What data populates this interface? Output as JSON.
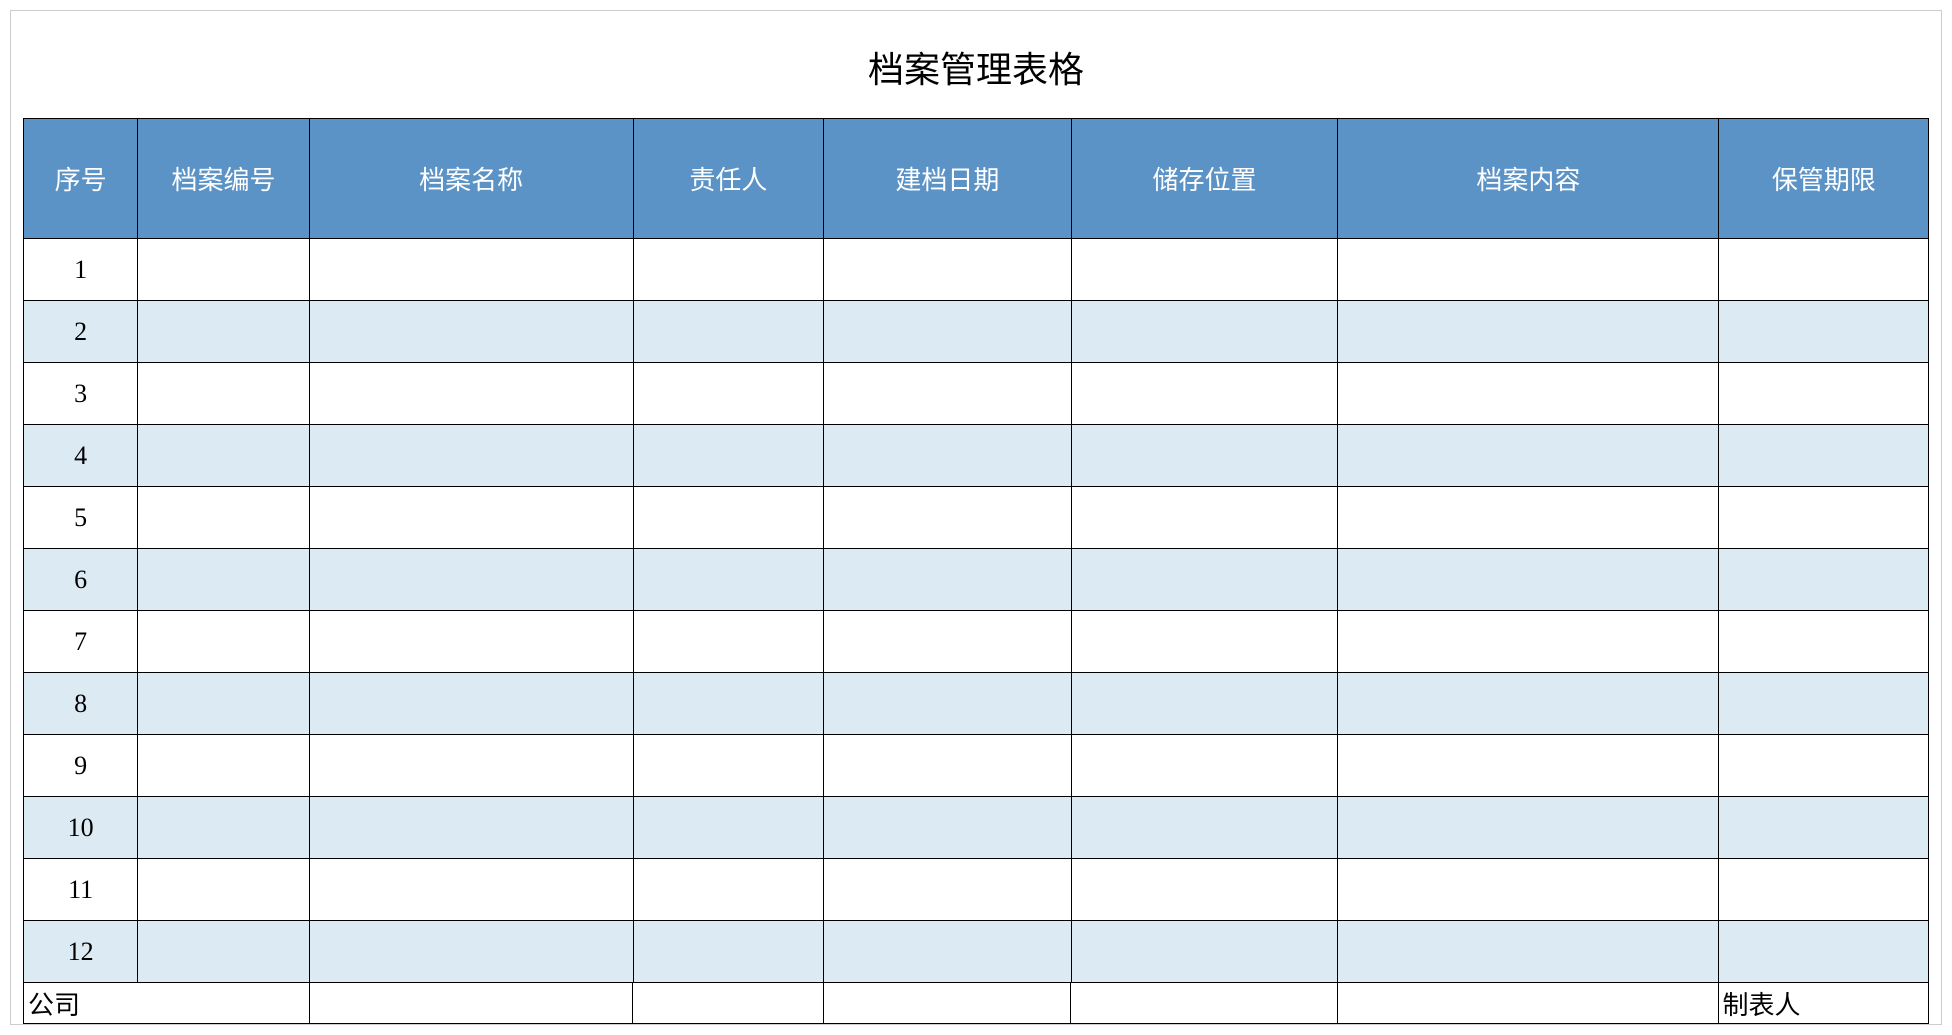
{
  "title": "档案管理表格",
  "headers": [
    "序号",
    "档案编号",
    "档案名称",
    "责任人",
    "建档日期",
    "储存位置",
    "档案内容",
    "保管期限"
  ],
  "rows": [
    {
      "seq": "1",
      "num": "",
      "name": "",
      "owner": "",
      "date": "",
      "loc": "",
      "content": "",
      "period": ""
    },
    {
      "seq": "2",
      "num": "",
      "name": "",
      "owner": "",
      "date": "",
      "loc": "",
      "content": "",
      "period": ""
    },
    {
      "seq": "3",
      "num": "",
      "name": "",
      "owner": "",
      "date": "",
      "loc": "",
      "content": "",
      "period": ""
    },
    {
      "seq": "4",
      "num": "",
      "name": "",
      "owner": "",
      "date": "",
      "loc": "",
      "content": "",
      "period": ""
    },
    {
      "seq": "5",
      "num": "",
      "name": "",
      "owner": "",
      "date": "",
      "loc": "",
      "content": "",
      "period": ""
    },
    {
      "seq": "6",
      "num": "",
      "name": "",
      "owner": "",
      "date": "",
      "loc": "",
      "content": "",
      "period": ""
    },
    {
      "seq": "7",
      "num": "",
      "name": "",
      "owner": "",
      "date": "",
      "loc": "",
      "content": "",
      "period": ""
    },
    {
      "seq": "8",
      "num": "",
      "name": "",
      "owner": "",
      "date": "",
      "loc": "",
      "content": "",
      "period": ""
    },
    {
      "seq": "9",
      "num": "",
      "name": "",
      "owner": "",
      "date": "",
      "loc": "",
      "content": "",
      "period": ""
    },
    {
      "seq": "10",
      "num": "",
      "name": "",
      "owner": "",
      "date": "",
      "loc": "",
      "content": "",
      "period": ""
    },
    {
      "seq": "11",
      "num": "",
      "name": "",
      "owner": "",
      "date": "",
      "loc": "",
      "content": "",
      "period": ""
    },
    {
      "seq": "12",
      "num": "",
      "name": "",
      "owner": "",
      "date": "",
      "loc": "",
      "content": "",
      "period": ""
    }
  ],
  "footer": {
    "company_label": "公司",
    "preparer_label": "制表人"
  }
}
